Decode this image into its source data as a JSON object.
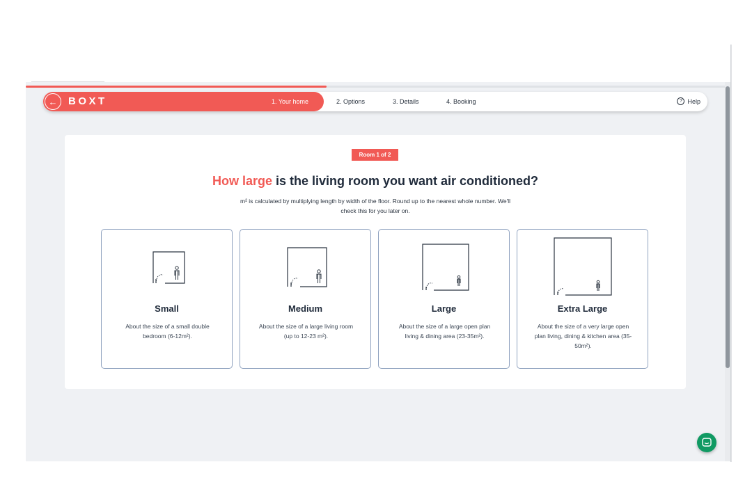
{
  "brand": "BOXT",
  "progress": 0.43,
  "nav": {
    "steps": [
      {
        "label": "1. Your home",
        "active": true
      },
      {
        "label": "2. Options",
        "active": false
      },
      {
        "label": "3. Details",
        "active": false
      },
      {
        "label": "4. Booking",
        "active": false
      }
    ],
    "help_label": "Help"
  },
  "card": {
    "badge": "Room 1 of 2",
    "headline_accent": "How large",
    "headline_rest": " is the living room you want air conditioned?",
    "subtext": "m² is calculated by multiplying length by width of the floor. Round up to the nearest whole number. We'll check this for you later on.",
    "options": [
      {
        "title": "Small",
        "description": "About the size of a small double bedroom (6-12m²)."
      },
      {
        "title": "Medium",
        "description": "About the size of a large living room (up to 12-23 m²)."
      },
      {
        "title": "Large",
        "description": "About the size of a large open plan living & dining area (23-35m²)."
      },
      {
        "title": "Extra Large",
        "description": "About the size of a very large open plan living, dining & kitchen area (35-50m²)."
      }
    ]
  },
  "colors": {
    "accent": "#f15a55",
    "background": "#eff1f4",
    "card_border": "#8fa2bf",
    "chat": "#109a63"
  },
  "icons": {
    "back": "arrow-left-icon",
    "help": "question-circle-icon",
    "room": "room-floorplan-icon",
    "chat": "chat-bubble-icon"
  }
}
